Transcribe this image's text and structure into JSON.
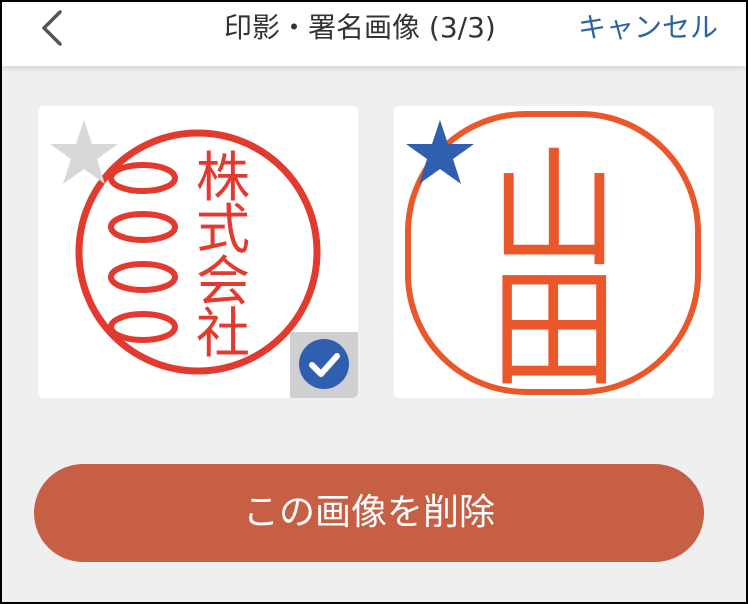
{
  "header": {
    "title": "印影・署名画像 (3/3)",
    "cancel_label": "キャンセル",
    "back_icon": "chevron-left-icon"
  },
  "images": [
    {
      "stamp_text": "株式会社",
      "starred": false,
      "selected": true
    },
    {
      "stamp_text": "山田",
      "starred": true,
      "selected": false
    }
  ],
  "colors": {
    "stamp_red": "#e33a2f",
    "stamp_orange": "#e9572a",
    "star_active": "#2f5fae",
    "star_inactive": "#d8d8da",
    "check_badge": "#2f5fae",
    "delete_button": "#c75f45",
    "cancel_text": "#2d62a4",
    "background": "#efeff0"
  },
  "actions": {
    "delete_label": "この画像を削除"
  }
}
